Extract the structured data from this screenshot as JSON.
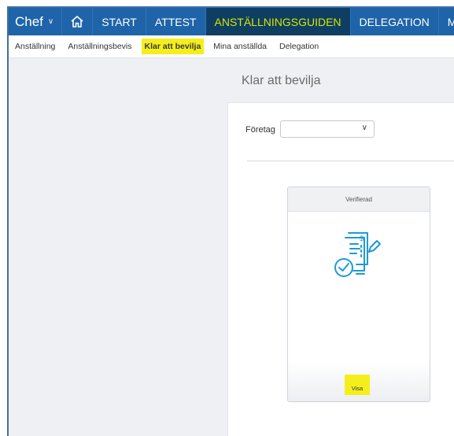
{
  "topnav": {
    "role_label": "Chef",
    "items": [
      {
        "label": "START"
      },
      {
        "label": "ATTEST"
      },
      {
        "label": "ANSTÄLLNINGSGUIDEN"
      },
      {
        "label": "DELEGATION"
      },
      {
        "label": "MINA AN"
      }
    ]
  },
  "subnav": {
    "items": [
      {
        "label": "Anställning"
      },
      {
        "label": "Anställningsbevis"
      },
      {
        "label": "Klar att bevilja"
      },
      {
        "label": "Mina anställda"
      },
      {
        "label": "Delegation"
      }
    ]
  },
  "page": {
    "title": "Klar att bevilja",
    "company_label": "Företag",
    "company_value": ""
  },
  "card": {
    "header": "Verifierad",
    "button_label": "Visa"
  },
  "colors": {
    "nav_bg": "#1f64a8",
    "nav_active_bg": "#0e3f63",
    "nav_active_text": "#d8e600",
    "highlight": "#f4ef1c",
    "icon_blue": "#1d9ad6"
  }
}
